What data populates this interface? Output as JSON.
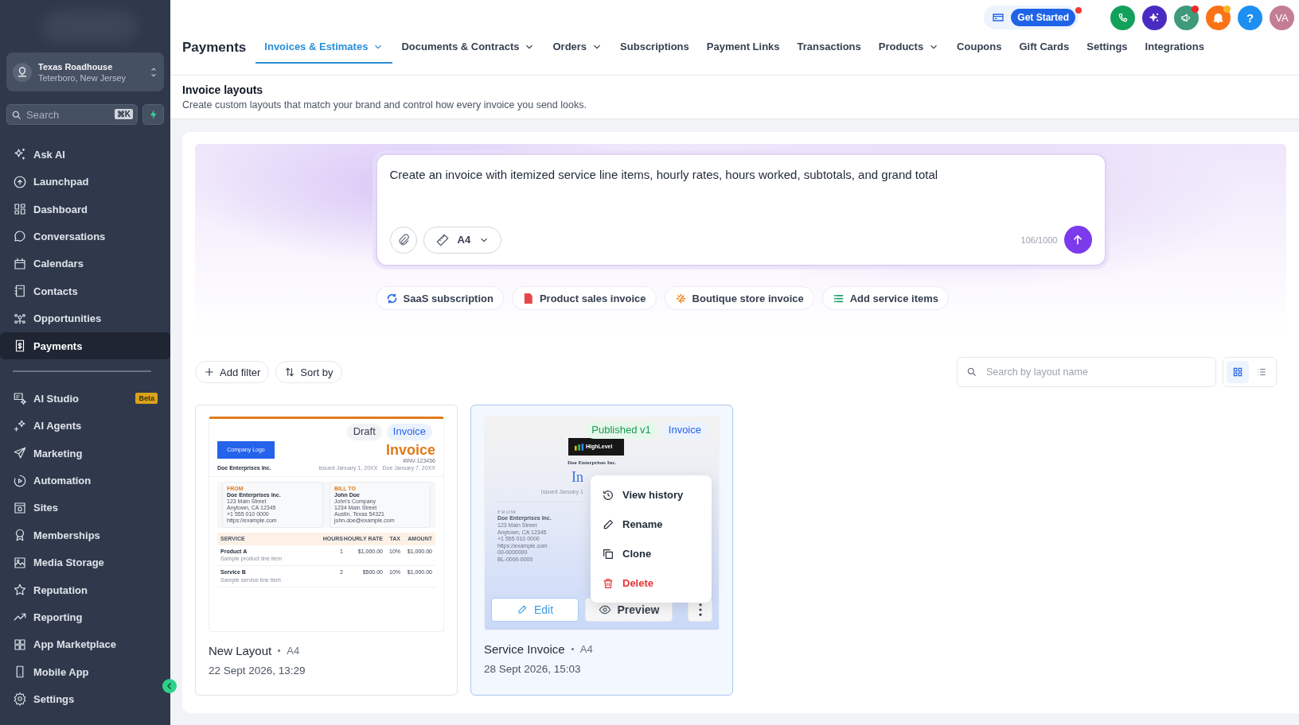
{
  "sidebar": {
    "account": {
      "name": "Texas Roadhouse",
      "location": "Teterboro, New Jersey"
    },
    "search": {
      "placeholder": "Search",
      "shortcut": "⌘K"
    },
    "items": [
      {
        "label": "Ask AI",
        "selected": false
      },
      {
        "label": "Launchpad",
        "selected": false
      },
      {
        "label": "Dashboard",
        "selected": false
      },
      {
        "label": "Conversations",
        "selected": false
      },
      {
        "label": "Calendars",
        "selected": false
      },
      {
        "label": "Contacts",
        "selected": false
      },
      {
        "label": "Opportunities",
        "selected": false
      },
      {
        "label": "Payments",
        "selected": true
      }
    ],
    "items_2": [
      {
        "label": "AI Studio",
        "selected": false,
        "badge": "Beta"
      },
      {
        "label": "AI Agents",
        "selected": false
      },
      {
        "label": "Marketing",
        "selected": false
      },
      {
        "label": "Automation",
        "selected": false
      },
      {
        "label": "Sites",
        "selected": false
      },
      {
        "label": "Memberships",
        "selected": false
      },
      {
        "label": "Media Storage",
        "selected": false
      },
      {
        "label": "Reputation",
        "selected": false
      },
      {
        "label": "Reporting",
        "selected": false
      },
      {
        "label": "App Marketplace",
        "selected": false
      },
      {
        "label": "Mobile App",
        "selected": false
      }
    ],
    "footer_item": {
      "label": "Settings",
      "selected": false
    }
  },
  "topbar": {
    "get_started": {
      "label": "Get Started",
      "dot": true
    },
    "icons": [
      {
        "kind": "phone"
      },
      {
        "kind": "ai"
      },
      {
        "kind": "megaphone",
        "color": "#f0262b"
      },
      {
        "kind": "bell",
        "color": "#f7b423"
      },
      {
        "kind": "help",
        "label": "?"
      }
    ],
    "avatar": "VA"
  },
  "header": {
    "title": "Payments",
    "tabs": [
      {
        "label": "Invoices & Estimates",
        "selected": true,
        "dropdown": true
      },
      {
        "label": "Documents & Contracts",
        "selected": false,
        "dropdown": true
      },
      {
        "label": "Orders",
        "selected": false,
        "dropdown": true
      },
      {
        "label": "Subscriptions",
        "selected": false,
        "dropdown": false
      },
      {
        "label": "Payment Links",
        "selected": false,
        "dropdown": false
      },
      {
        "label": "Transactions",
        "selected": false,
        "dropdown": false
      },
      {
        "label": "Products",
        "selected": false,
        "dropdown": true
      },
      {
        "label": "Coupons",
        "selected": false,
        "dropdown": false
      },
      {
        "label": "Gift Cards",
        "selected": false,
        "dropdown": false
      },
      {
        "label": "Settings",
        "selected": false,
        "dropdown": false
      },
      {
        "label": "Integrations",
        "selected": false,
        "dropdown": false
      }
    ]
  },
  "page": {
    "title": "Invoice layouts",
    "description": "Create custom layouts that match your brand and control how every invoice you send looks."
  },
  "prompt": {
    "value": "Create an invoice with itemized service line items, hourly rates, hours worked, subtotals, and grand total",
    "paper_size": "A4",
    "counter": "106/1000"
  },
  "suggestions": [
    {
      "label": "SaaS subscription",
      "color": "#2f6fe4"
    },
    {
      "label": "Product sales invoice",
      "color": "#e5484d"
    },
    {
      "label": "Boutique store invoice",
      "color": "#f08a24"
    },
    {
      "label": "Add service items",
      "color": "#22a06b"
    }
  ],
  "toolbar": {
    "filter": "Add filter",
    "sort": "Sort by",
    "search_placeholder": "Search by layout name",
    "views": [
      {
        "selected": true
      },
      {
        "selected": false
      }
    ]
  },
  "layouts": [
    {
      "name": "New Layout",
      "size": "A4",
      "date": "22 Sept 2026, 13:29",
      "selected": false,
      "status": "Draft",
      "published": false,
      "type": "Invoice",
      "preview": {
        "kind": "modern",
        "logo": "Company Logo",
        "company": "Doe Enterprises Inc.",
        "heading": "Invoice",
        "number": "#INV-123456",
        "issued": "Issued January 1, 20XX",
        "due": "Due January 7, 20XX",
        "from": {
          "label": "FROM",
          "name": "Doe Enterprises Inc.",
          "lines": [
            "123 Main Street",
            "Anytown, CA 12345",
            "+1 555 010 0000",
            "https://example.com"
          ]
        },
        "bill_to": {
          "label": "BILL TO",
          "name": "John Doe",
          "lines": [
            "John's Company",
            "1234 Main Street",
            "Austin, Texas 54321",
            "john.doe@example.com"
          ]
        },
        "columns": [
          "SERVICE",
          "HOURS",
          "HOURLY RATE",
          "TAX",
          "AMOUNT"
        ],
        "rows": [
          {
            "cells": [
              "Product A",
              "1",
              "$1,000.00",
              "10%",
              "$1,000.00"
            ],
            "note": "Sample product line item"
          },
          {
            "cells": [
              "Service B",
              "2",
              "$500.00",
              "10%",
              "$1,000.00"
            ],
            "note": "Sample service line item"
          }
        ]
      }
    },
    {
      "name": "Service Invoice",
      "size": "A4",
      "date": "28 Sept 2026, 15:03",
      "selected": true,
      "status": "Published v1",
      "published": true,
      "type": "Invoice",
      "preview": {
        "kind": "classic",
        "logo": "HighLevel",
        "company": "Doe Enterprises Inc.",
        "heading": "In",
        "issued": "Issued January 1",
        "from": {
          "label": "FROM",
          "name": "Doe Enterprises Inc.",
          "lines": [
            "123 Main Street",
            "Anytown, CA 12345",
            "+1 555 010 0000",
            "https://example.com",
            "00-0000000",
            "BL-0000-0000"
          ]
        }
      },
      "actions": {
        "edit": "Edit",
        "preview": "Preview"
      },
      "menu": [
        {
          "label": "View history",
          "kind": "normal"
        },
        {
          "label": "Rename",
          "kind": "normal"
        },
        {
          "label": "Clone",
          "kind": "normal"
        },
        {
          "label": "Delete",
          "kind": "danger"
        }
      ]
    }
  ]
}
